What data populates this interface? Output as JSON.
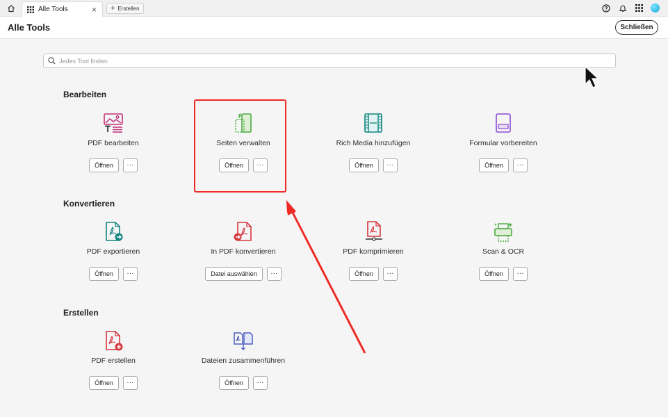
{
  "topbar": {
    "tab_label": "Alle Tools",
    "tab_close": "×",
    "new_tab_label": "Erstellen"
  },
  "header": {
    "title": "Alle Tools",
    "close_label": "Schließen"
  },
  "search": {
    "placeholder": "Jedes Tool finden"
  },
  "sections": {
    "edit": {
      "title": "Bearbeiten",
      "tools": [
        {
          "label": "PDF bearbeiten",
          "action": "Öffnen",
          "icon": "edit-pdf-icon"
        },
        {
          "label": "Seiten verwalten",
          "action": "Öffnen",
          "icon": "organize-pages-icon"
        },
        {
          "label": "Rich Media hinzufügen",
          "action": "Öffnen",
          "icon": "rich-media-icon"
        },
        {
          "label": "Formular vorbereiten",
          "action": "Öffnen",
          "icon": "prepare-form-icon"
        }
      ]
    },
    "convert": {
      "title": "Konvertieren",
      "tools": [
        {
          "label": "PDF exportieren",
          "action": "Öffnen",
          "icon": "export-pdf-icon"
        },
        {
          "label": "In PDF konvertieren",
          "action": "Datei auswählen",
          "icon": "convert-to-pdf-icon"
        },
        {
          "label": "PDF komprimieren",
          "action": "Öffnen",
          "icon": "compress-pdf-icon"
        },
        {
          "label": "Scan & OCR",
          "action": "Öffnen",
          "icon": "scan-ocr-icon"
        }
      ]
    },
    "create": {
      "title": "Erstellen",
      "tools": [
        {
          "label": "PDF erstellen",
          "action": "Öffnen",
          "icon": "create-pdf-icon"
        },
        {
          "label": "Dateien zusammenführen",
          "action": "Öffnen",
          "icon": "combine-files-icon"
        }
      ]
    }
  },
  "more_label": "···",
  "colors": {
    "accent_red": "#ee2a24",
    "pdf_red": "#d7373f",
    "green": "#4aab3f",
    "teal": "#12847e",
    "purple": "#8c4bd6",
    "pink": "#c2307a"
  }
}
